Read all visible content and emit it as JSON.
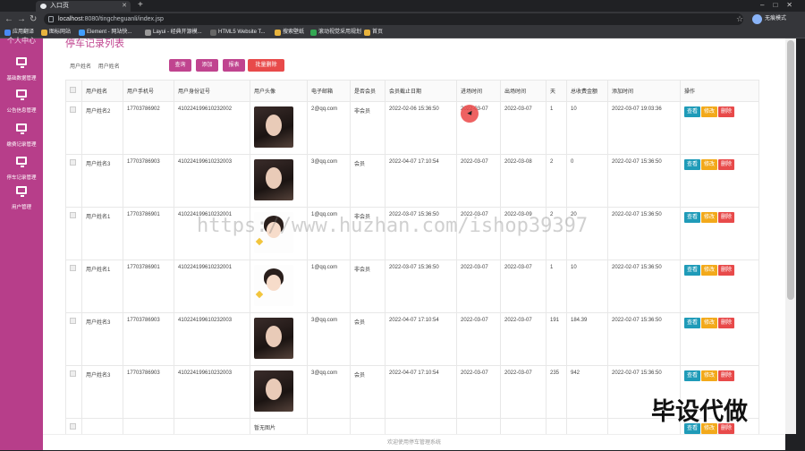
{
  "browser": {
    "tabs": [
      "",
      "",
      "入口页"
    ],
    "url_host": "localhost",
    "url_rest": ":8080/tingcheguanli/index.jsp",
    "profile": "无痕模式",
    "bookmarks": [
      "应用翻译",
      "图标网站",
      "Element - 网站快...",
      "Layui - 经典开源模...",
      "HTML5 Website T...",
      "搜索壁纸",
      "滚动视觉采用规划",
      "首页"
    ]
  },
  "sidebar": {
    "title": "个人中心",
    "items": [
      "基础数据管理",
      "公告信息管理",
      "缴费记录管理",
      "停车记录管理",
      "用户管理"
    ]
  },
  "page": {
    "title": "停车记录列表",
    "filter_label": "用户姓名",
    "filter_placeholder": "用户姓名",
    "buttons": {
      "query": "查询",
      "add": "添加",
      "report": "报表",
      "batch_delete": "批量删除"
    }
  },
  "table": {
    "headers": [
      "用户姓名",
      "用户手机号",
      "用户身份证号",
      "用户头像",
      "电子邮箱",
      "是否会员",
      "会员截止日期",
      "进场时间",
      "出场时间",
      "天",
      "总收费金额",
      "添加时间",
      "操作"
    ],
    "rows": [
      {
        "name": "用户姓名2",
        "phone": "17703786902",
        "idcard": "410224199610232002",
        "avatar": "dark",
        "email": "2@qq.com",
        "member": "非会员",
        "expire": "2022-02-06 15:36:50",
        "in": "2022-03-07",
        "out": "2022-03-07",
        "days": "1",
        "amount": "10",
        "added": "2022-03-07 19:03:36"
      },
      {
        "name": "用户姓名3",
        "phone": "17703786903",
        "idcard": "410224199610232003",
        "avatar": "dark",
        "email": "3@qq.com",
        "member": "会员",
        "expire": "2022-04-07 17:10:54",
        "in": "2022-03-07",
        "out": "2022-03-08",
        "days": "2",
        "amount": "0",
        "added": "2022-02-07 15:36:50"
      },
      {
        "name": "用户姓名1",
        "phone": "17703786901",
        "idcard": "410224199610232001",
        "avatar": "cartoon",
        "email": "1@qq.com",
        "member": "非会员",
        "expire": "2022-03-07 15:36:50",
        "in": "2022-03-07",
        "out": "2022-03-09",
        "days": "2",
        "amount": "20",
        "added": "2022-02-07 15:36:50"
      },
      {
        "name": "用户姓名1",
        "phone": "17703786901",
        "idcard": "410224199610232001",
        "avatar": "cartoon",
        "email": "1@qq.com",
        "member": "非会员",
        "expire": "2022-03-07 15:36:50",
        "in": "2022-03-07",
        "out": "2022-03-07",
        "days": "1",
        "amount": "10",
        "added": "2022-02-07 15:36:50"
      },
      {
        "name": "用户姓名3",
        "phone": "17703786903",
        "idcard": "410224199610232003",
        "avatar": "dark",
        "email": "3@qq.com",
        "member": "会员",
        "expire": "2022-04-07 17:10:54",
        "in": "2022-03-07",
        "out": "2022-03-07",
        "days": "191",
        "amount": "184.39",
        "added": "2022-02-07 15:36:50"
      },
      {
        "name": "用户姓名3",
        "phone": "17703786903",
        "idcard": "410224199610232003",
        "avatar": "dark",
        "email": "3@qq.com",
        "member": "会员",
        "expire": "2022-04-07 17:10:54",
        "in": "2022-03-07",
        "out": "2022-03-07",
        "days": "235",
        "amount": "942",
        "added": "2022-02-07 15:36:50"
      }
    ],
    "partial_row_text": "暂无图片",
    "actions": {
      "view": "查看",
      "edit": "修改",
      "delete": "删除"
    }
  },
  "footer": "欢迎使用停车管理系统",
  "watermarks": [
    "https://www.huzhan.com/ishop39397",
    "毕设代做"
  ]
}
